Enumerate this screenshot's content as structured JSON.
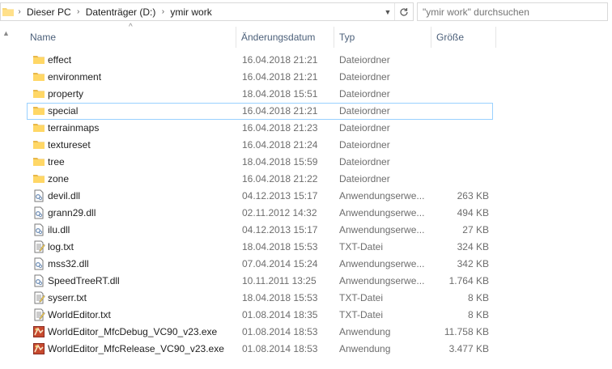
{
  "address_bar": {
    "breadcrumbs": [
      "Dieser PC",
      "Datenträger (D:)",
      "ymir work"
    ]
  },
  "search": {
    "placeholder": "\"ymir work\" durchsuchen"
  },
  "columns": {
    "name": "Name",
    "date": "Änderungsdatum",
    "type": "Typ",
    "size": "Größe"
  },
  "files": [
    {
      "name": "effect",
      "date": "16.04.2018 21:21",
      "type": "Dateiordner",
      "size": "",
      "icon": "folder-icon"
    },
    {
      "name": "environment",
      "date": "16.04.2018 21:21",
      "type": "Dateiordner",
      "size": "",
      "icon": "folder-icon"
    },
    {
      "name": "property",
      "date": "18.04.2018 15:51",
      "type": "Dateiordner",
      "size": "",
      "icon": "folder-icon"
    },
    {
      "name": "special",
      "date": "16.04.2018 21:21",
      "type": "Dateiordner",
      "size": "",
      "icon": "folder-icon",
      "selected": true
    },
    {
      "name": "terrainmaps",
      "date": "16.04.2018 21:23",
      "type": "Dateiordner",
      "size": "",
      "icon": "folder-icon"
    },
    {
      "name": "textureset",
      "date": "16.04.2018 21:24",
      "type": "Dateiordner",
      "size": "",
      "icon": "folder-icon"
    },
    {
      "name": "tree",
      "date": "18.04.2018 15:59",
      "type": "Dateiordner",
      "size": "",
      "icon": "folder-icon"
    },
    {
      "name": "zone",
      "date": "16.04.2018 21:22",
      "type": "Dateiordner",
      "size": "",
      "icon": "folder-icon"
    },
    {
      "name": "devil.dll",
      "date": "04.12.2013 15:17",
      "type": "Anwendungserwe...",
      "size": "263 KB",
      "icon": "dll-file-icon"
    },
    {
      "name": "grann29.dll",
      "date": "02.11.2012 14:32",
      "type": "Anwendungserwe...",
      "size": "494 KB",
      "icon": "dll-file-icon"
    },
    {
      "name": "ilu.dll",
      "date": "04.12.2013 15:17",
      "type": "Anwendungserwe...",
      "size": "27 KB",
      "icon": "dll-file-icon"
    },
    {
      "name": "log.txt",
      "date": "18.04.2018 15:53",
      "type": "TXT-Datei",
      "size": "324 KB",
      "icon": "text-file-icon"
    },
    {
      "name": "mss32.dll",
      "date": "07.04.2014 15:24",
      "type": "Anwendungserwe...",
      "size": "342 KB",
      "icon": "dll-file-icon"
    },
    {
      "name": "SpeedTreeRT.dll",
      "date": "10.11.2011 13:25",
      "type": "Anwendungserwe...",
      "size": "1.764 KB",
      "icon": "dll-file-icon"
    },
    {
      "name": "syserr.txt",
      "date": "18.04.2018 15:53",
      "type": "TXT-Datei",
      "size": "8 KB",
      "icon": "text-file-icon"
    },
    {
      "name": "WorldEditor.txt",
      "date": "01.08.2014 18:35",
      "type": "TXT-Datei",
      "size": "8 KB",
      "icon": "text-file-icon"
    },
    {
      "name": "WorldEditor_MfcDebug_VC90_v23.exe",
      "date": "01.08.2014 18:53",
      "type": "Anwendung",
      "size": "11.758 KB",
      "icon": "exe-app-icon"
    },
    {
      "name": "WorldEditor_MfcRelease_VC90_v23.exe",
      "date": "01.08.2014 18:53",
      "type": "Anwendung",
      "size": "3.477 KB",
      "icon": "exe-app-icon"
    }
  ]
}
